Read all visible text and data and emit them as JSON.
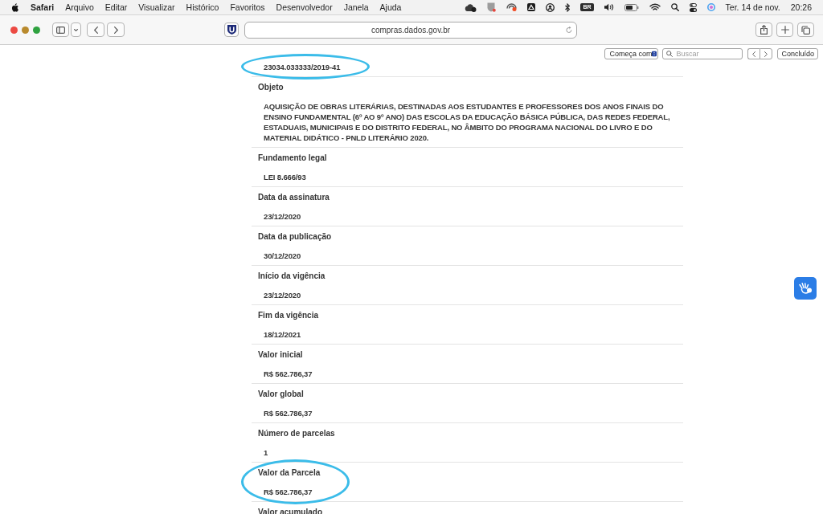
{
  "menu_bar": {
    "app_name": "Safari",
    "menus": [
      "Arquivo",
      "Editar",
      "Visualizar",
      "Histórico",
      "Favoritos",
      "Desenvolvedor",
      "Janela",
      "Ajuda"
    ],
    "input_source": "BR",
    "date": "Ter. 14 de nov.",
    "time": "20:26"
  },
  "toolbar": {
    "address": "compras.dados.gov.br"
  },
  "find_bar": {
    "match_mode": "Começa com",
    "search": {
      "placeholder": "Buscar"
    },
    "done_button": "Concluído"
  },
  "details": [
    {
      "value": "23034.033333/2019-41",
      "circled": true
    },
    {
      "label": "Objeto",
      "value": "AQUISIÇÃO DE OBRAS LITERÁRIAS, DESTINADAS AOS ESTUDANTES E PROFESSORES DOS ANOS FINAIS DO ENSINO FUNDAMENTAL (6º AO 9º ANO) DAS ESCOLAS DA EDUCAÇÃO BÁSICA PÚBLICA, DAS REDES FEDERAL, ESTADUAIS, MUNICIPAIS E DO DISTRITO FEDERAL, NO ÂMBITO DO PROGRAMA NACIONAL DO LIVRO E DO MATERIAL DIDÁTICO - PNLD LITERÁRIO 2020.",
      "circled": false
    },
    {
      "label": "Fundamento legal",
      "value": "LEI 8.666/93",
      "circled": false
    },
    {
      "label": "Data da assinatura",
      "value": "23/12/2020",
      "circled": false
    },
    {
      "label": "Data da publicação",
      "value": "30/12/2020",
      "circled": false
    },
    {
      "label": "Início da vigência",
      "value": "23/12/2020",
      "circled": false
    },
    {
      "label": "Fim da vigência",
      "value": "18/12/2021",
      "circled": false
    },
    {
      "label": "Valor inicial",
      "value": "R$ 562.786,37",
      "circled": false
    },
    {
      "label": "Valor global",
      "value": "R$ 562.786,37",
      "circled": false
    },
    {
      "label": "Número de parcelas",
      "value": "1",
      "circled": false
    },
    {
      "label": "Valor da Parcela",
      "value": "R$ 562.786,37",
      "circled": true
    },
    {
      "label": "Valor acumulado",
      "circled": false
    }
  ]
}
